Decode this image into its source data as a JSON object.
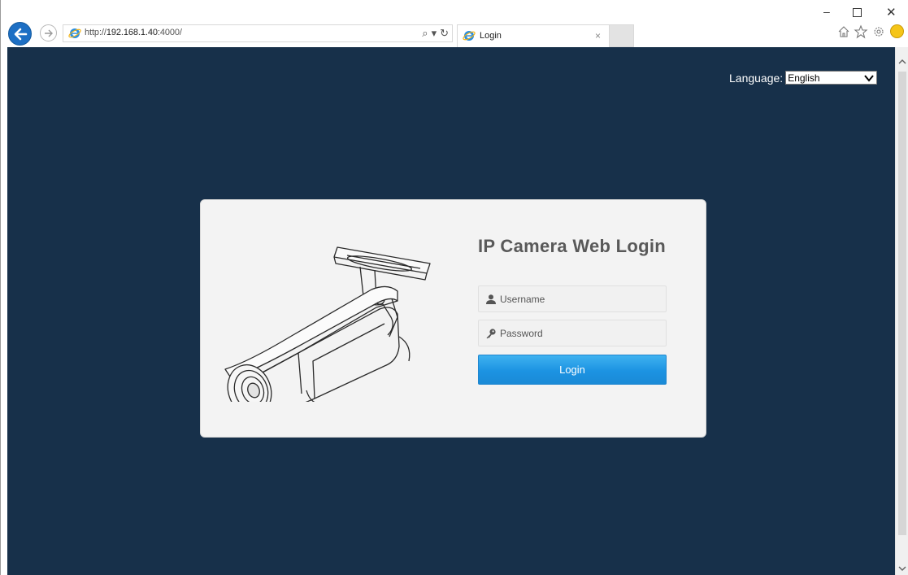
{
  "browser": {
    "address": {
      "scheme": "http://",
      "host": "192.168.1.40",
      "port_path": ":4000/"
    },
    "address_tools": {
      "search_glyph": "⌕",
      "dropdown_glyph": "▾",
      "refresh_glyph": "↻"
    },
    "tab": {
      "title": "Login",
      "close_glyph": "×"
    },
    "window_controls": {
      "minimize": "–",
      "close": "✕"
    },
    "icons": [
      "back-icon",
      "forward-icon",
      "home-icon",
      "favorites-star-icon",
      "settings-gear-icon",
      "feedback-smiley-icon"
    ]
  },
  "page": {
    "background": "#17304a",
    "language": {
      "label": "Language:",
      "selected": "English"
    },
    "login": {
      "title": "IP Camera Web Login",
      "username_placeholder": "Username",
      "password_placeholder": "Password",
      "button_label": "Login",
      "button_color": "#1c93e2"
    }
  }
}
